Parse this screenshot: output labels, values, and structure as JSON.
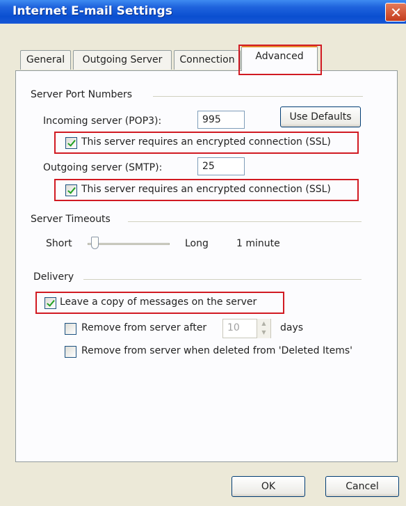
{
  "window": {
    "title": "Internet E-mail Settings",
    "close_glyph": "✕"
  },
  "tabs": [
    {
      "label": "General"
    },
    {
      "label": "Outgoing Server"
    },
    {
      "label": "Connection"
    },
    {
      "label": "Advanced",
      "active": true
    }
  ],
  "server_ports": {
    "section_label": "Server Port Numbers",
    "incoming_label": "Incoming server (POP3):",
    "incoming_value": "995",
    "use_defaults_label": "Use Defaults",
    "incoming_ssl_label": "This server requires an encrypted connection (SSL)",
    "incoming_ssl_checked": true,
    "outgoing_label": "Outgoing server (SMTP):",
    "outgoing_value": "25",
    "outgoing_ssl_label": "This server requires an encrypted connection (SSL)",
    "outgoing_ssl_checked": true
  },
  "timeouts": {
    "section_label": "Server Timeouts",
    "short_label": "Short",
    "long_label": "Long",
    "value_label": "1 minute"
  },
  "delivery": {
    "section_label": "Delivery",
    "leave_copy_label": "Leave a copy of messages on the server",
    "leave_copy_checked": true,
    "remove_after_label": "Remove from server after",
    "remove_after_checked": false,
    "remove_after_days": "10",
    "days_label": "days",
    "remove_deleted_label": "Remove from server when deleted from 'Deleted Items'",
    "remove_deleted_checked": false
  },
  "footer": {
    "ok_label": "OK",
    "cancel_label": "Cancel"
  },
  "colors": {
    "highlight_box": "#d11a22",
    "titlebar": "#0a4fd0",
    "dialog_bg": "#ece9d8"
  }
}
